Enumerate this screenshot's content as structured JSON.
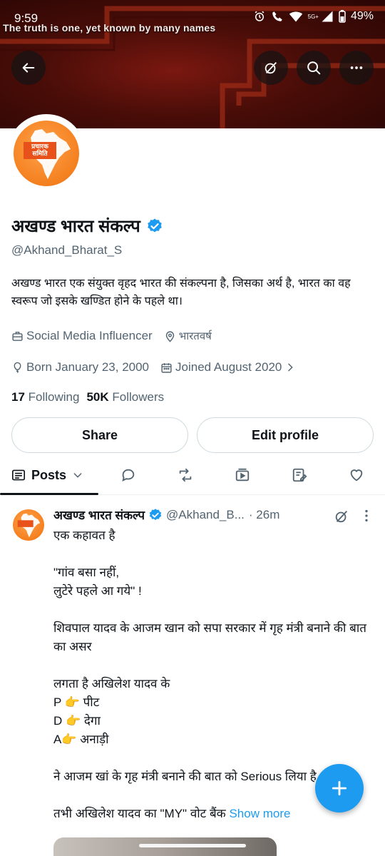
{
  "status_bar": {
    "time": "9:59",
    "network": "5G+",
    "battery": "49%"
  },
  "banner": {
    "caption": "The truth is one, yet known by many names",
    "colors": {
      "base": "#4a0d08",
      "pattern": "#9a2a16"
    }
  },
  "header": {
    "back_icon": "arrow-left-icon",
    "grok_icon": "grok-icon",
    "search_icon": "search-icon",
    "more_icon": "more-horizontal-icon"
  },
  "avatar": {
    "logo_text_line1": "प्रचारक",
    "logo_text_line2": "समिति",
    "color": "#f4801f"
  },
  "profile": {
    "name": "अखण्ड भारत संकल्प",
    "handle": "@Akhand_Bharat_S",
    "bio": "अखण्ड भारत एक संयुक्त वृहद भारत की संकल्पना है, जिसका अर्थ है, भारत का वह स्वरूप जो इसके खण्डित होने के पहले था।",
    "category": "Social Media Influencer",
    "location": "भारतवर्ष",
    "born": "Born January 23, 2000",
    "joined": "Joined August 2020",
    "following_count": "17",
    "following_label": "Following",
    "followers_count": "50K",
    "followers_label": "Followers",
    "verified_color": "#1d9bf0"
  },
  "actions": {
    "share_label": "Share",
    "edit_label": "Edit profile"
  },
  "tabs": {
    "posts_label": "Posts",
    "icons": [
      "reply-icon",
      "repost-icon",
      "media-icon",
      "articles-icon",
      "likes-icon"
    ]
  },
  "post": {
    "author": "अखण्ड भारत संकल्प",
    "handle": "@Akhand_B...",
    "time": "· 26m",
    "lines": {
      "l1": "एक कहावत है",
      "l2": "\"गांव बसा नहीं,",
      "l3": "लुटेरे पहले आ गये\" !",
      "l4": "शिवपाल यादव के आजम खान को सपा सरकार में गृह मंत्री बनाने की बात का असर",
      "l5": "लगता है अखिलेश यादव के",
      "l6": "P 👉 पीट",
      "l7": "D 👉 देगा",
      "l8": "A👉 अनाड़ी",
      "l9": "ने आजम खां के गृह मंत्री बनाने की बात को Serious  लिया है ।",
      "l10": "तभी अखिलेश यादव का \"MY\" वोट बैंक"
    },
    "show_more": "Show more"
  },
  "fab": {
    "icon": "plus-icon",
    "color": "#1d9bf0"
  }
}
